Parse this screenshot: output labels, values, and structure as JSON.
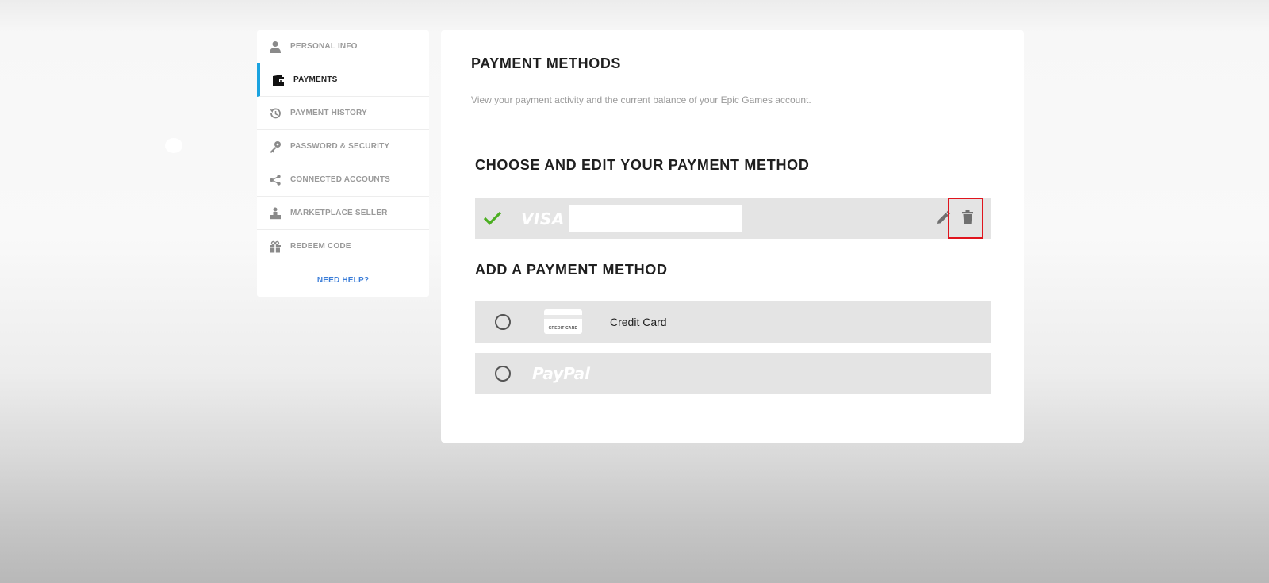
{
  "sidebar": {
    "items": [
      {
        "label": "PERSONAL INFO",
        "icon": "person-icon"
      },
      {
        "label": "PAYMENTS",
        "icon": "wallet-icon",
        "active": true
      },
      {
        "label": "PAYMENT HISTORY",
        "icon": "history-icon"
      },
      {
        "label": "PASSWORD & SECURITY",
        "icon": "key-icon"
      },
      {
        "label": "CONNECTED ACCOUNTS",
        "icon": "share-icon"
      },
      {
        "label": "MARKETPLACE SELLER",
        "icon": "seller-icon"
      },
      {
        "label": "REDEEM CODE",
        "icon": "gift-icon"
      }
    ],
    "need_help": "NEED HELP?"
  },
  "main": {
    "title": "PAYMENT METHODS",
    "subtitle": "View your payment activity and the current balance of your Epic Games account.",
    "choose_section": {
      "title": "CHOOSE AND EDIT YOUR PAYMENT METHOD",
      "saved_method": {
        "brand": "VISA",
        "number_value": "",
        "selected": true
      }
    },
    "add_section": {
      "title": "ADD A PAYMENT METHOD",
      "options": [
        {
          "label": "Credit Card",
          "graphic_text": "CREDIT CARD"
        },
        {
          "brand": "PayPal"
        }
      ]
    }
  },
  "colors": {
    "active_accent": "#1aa3e0",
    "check_green": "#4caf22",
    "link_blue": "#3b7dd8",
    "highlight_red": "#e0141d"
  }
}
